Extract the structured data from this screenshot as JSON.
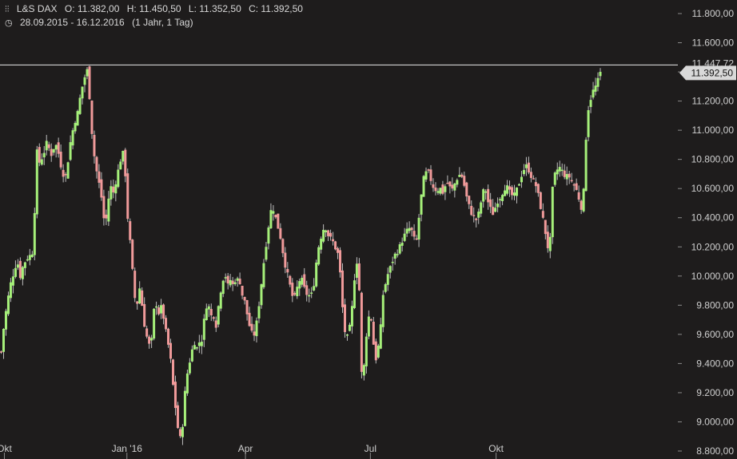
{
  "header": {
    "symbol": "L&S DAX",
    "open": "O: 11.382,00",
    "high": "H: 11.450,50",
    "low": "L: 11.352,50",
    "close": "C: 11.392,50",
    "range": "28.09.2015 - 16.12.2016",
    "interval": "(1 Jahr, 1 Tag)",
    "chart_type_icon": "candlestick-icon",
    "clock_icon": "clock-icon"
  },
  "colors": {
    "background": "#1e1c1c",
    "up": "#a6f07a",
    "down": "#f09a9a",
    "wick": "#bdbdbd",
    "text": "#cfcfcf",
    "price_line": "#e8e8e8",
    "last_price_box": "#d9d9d9"
  },
  "chart_data": {
    "type": "candlestick",
    "title": "L&S DAX",
    "x_range": [
      "2015-09-28",
      "2016-12-16"
    ],
    "x_tick_labels": [
      "Okt",
      "Jan '16",
      "Apr",
      "Jul",
      "Okt"
    ],
    "y_tick_labels": [
      "11.800,00",
      "11.600,00",
      "11.400,00",
      "11.200,00",
      "11.000,00",
      "10.800,00",
      "10.600,00",
      "10.400,00",
      "10.200,00",
      "10.000,00",
      "9.800,00",
      "9.600,00",
      "9.400,00",
      "9.200,00",
      "9.000,00",
      "8.800,00"
    ],
    "ylim": [
      8800,
      11900
    ],
    "grid": false,
    "horizontal_line_label": "11.447,72",
    "last_price_label": "11.392,50",
    "last_price": 11392.5,
    "high_line": 11447.72,
    "close_path": [
      [
        0,
        9480
      ],
      [
        2,
        9600
      ],
      [
        5,
        9720
      ],
      [
        8,
        9830
      ],
      [
        12,
        9950
      ],
      [
        16,
        10030
      ],
      [
        20,
        10110
      ],
      [
        24,
        10000
      ],
      [
        28,
        10080
      ],
      [
        32,
        10120
      ],
      [
        36,
        10140
      ],
      [
        40,
        10170
      ],
      [
        42,
        10450
      ],
      [
        45,
        10850
      ],
      [
        48,
        10780
      ],
      [
        52,
        10820
      ],
      [
        55,
        10870
      ],
      [
        58,
        10930
      ],
      [
        62,
        10820
      ],
      [
        66,
        10880
      ],
      [
        70,
        10900
      ],
      [
        74,
        10780
      ],
      [
        78,
        10700
      ],
      [
        82,
        10680
      ],
      [
        85,
        10850
      ],
      [
        88,
        10950
      ],
      [
        92,
        11050
      ],
      [
        96,
        11120
      ],
      [
        100,
        11250
      ],
      [
        104,
        11350
      ],
      [
        108,
        11410
      ],
      [
        110,
        11320
      ],
      [
        113,
        11050
      ],
      [
        116,
        10860
      ],
      [
        119,
        10750
      ],
      [
        122,
        10650
      ],
      [
        125,
        10600
      ],
      [
        128,
        10420
      ],
      [
        131,
        10350
      ],
      [
        134,
        10480
      ],
      [
        137,
        10640
      ],
      [
        140,
        10550
      ],
      [
        143,
        10620
      ],
      [
        146,
        10700
      ],
      [
        149,
        10770
      ],
      [
        152,
        10850
      ],
      [
        155,
        10820
      ],
      [
        158,
        10450
      ],
      [
        161,
        10300
      ],
      [
        164,
        10100
      ],
      [
        167,
        9900
      ],
      [
        170,
        9750
      ],
      [
        173,
        9950
      ],
      [
        176,
        9850
      ],
      [
        179,
        9700
      ],
      [
        182,
        9600
      ],
      [
        185,
        9550
      ],
      [
        188,
        9480
      ],
      [
        191,
        9720
      ],
      [
        194,
        9850
      ],
      [
        197,
        9720
      ],
      [
        200,
        9800
      ],
      [
        203,
        9750
      ],
      [
        206,
        9650
      ],
      [
        209,
        9550
      ],
      [
        212,
        9480
      ],
      [
        215,
        9300
      ],
      [
        218,
        9150
      ],
      [
        221,
        9000
      ],
      [
        224,
        8880
      ],
      [
        227,
        8900
      ],
      [
        230,
        9150
      ],
      [
        233,
        9300
      ],
      [
        236,
        9400
      ],
      [
        239,
        9450
      ],
      [
        242,
        9580
      ],
      [
        245,
        9480
      ],
      [
        248,
        9560
      ],
      [
        251,
        9520
      ],
      [
        254,
        9650
      ],
      [
        257,
        9780
      ],
      [
        260,
        9830
      ],
      [
        263,
        9700
      ],
      [
        266,
        9780
      ],
      [
        269,
        9620
      ],
      [
        272,
        9750
      ],
      [
        275,
        9880
      ],
      [
        278,
        9950
      ],
      [
        281,
        10050
      ],
      [
        284,
        9900
      ],
      [
        287,
        10000
      ],
      [
        290,
        9920
      ],
      [
        293,
        9980
      ],
      [
        296,
        9960
      ],
      [
        299,
        10000
      ],
      [
        302,
        9880
      ],
      [
        305,
        9850
      ],
      [
        308,
        9770
      ],
      [
        311,
        9680
      ],
      [
        314,
        9620
      ],
      [
        317,
        9580
      ],
      [
        320,
        9640
      ],
      [
        323,
        9760
      ],
      [
        326,
        9900
      ],
      [
        329,
        10050
      ],
      [
        332,
        10180
      ],
      [
        335,
        10300
      ],
      [
        338,
        10430
      ],
      [
        341,
        10480
      ],
      [
        344,
        10420
      ],
      [
        347,
        10350
      ],
      [
        350,
        10300
      ],
      [
        353,
        10200
      ],
      [
        356,
        10100
      ],
      [
        359,
        10030
      ],
      [
        362,
        9960
      ],
      [
        365,
        9880
      ],
      [
        368,
        9830
      ],
      [
        371,
        9900
      ],
      [
        374,
        9960
      ],
      [
        377,
        9990
      ],
      [
        380,
        9930
      ],
      [
        383,
        9880
      ],
      [
        386,
        9870
      ],
      [
        389,
        9860
      ],
      [
        392,
        9900
      ],
      [
        395,
        10050
      ],
      [
        398,
        10180
      ],
      [
        401,
        10250
      ],
      [
        404,
        10310
      ],
      [
        407,
        10350
      ],
      [
        410,
        10290
      ],
      [
        413,
        10260
      ],
      [
        416,
        10250
      ],
      [
        419,
        10200
      ],
      [
        422,
        10180
      ],
      [
        425,
        10100
      ],
      [
        428,
        9850
      ],
      [
        431,
        9650
      ],
      [
        434,
        9560
      ],
      [
        437,
        9620
      ],
      [
        440,
        9700
      ],
      [
        443,
        9950
      ],
      [
        446,
        10060
      ],
      [
        449,
        10180
      ],
      [
        452,
        9350
      ],
      [
        455,
        9300
      ],
      [
        458,
        9550
      ],
      [
        461,
        9700
      ],
      [
        464,
        9760
      ],
      [
        467,
        9600
      ],
      [
        470,
        9400
      ],
      [
        473,
        9500
      ],
      [
        476,
        9550
      ],
      [
        479,
        9850
      ],
      [
        482,
        9920
      ],
      [
        485,
        10000
      ],
      [
        488,
        10040
      ],
      [
        491,
        10090
      ],
      [
        494,
        10140
      ],
      [
        497,
        10160
      ],
      [
        500,
        10190
      ],
      [
        503,
        10230
      ],
      [
        506,
        10270
      ],
      [
        509,
        10300
      ],
      [
        512,
        10330
      ],
      [
        515,
        10320
      ],
      [
        518,
        10280
      ],
      [
        521,
        10200
      ],
      [
        524,
        10350
      ],
      [
        527,
        10500
      ],
      [
        530,
        10650
      ],
      [
        533,
        10700
      ],
      [
        536,
        10720
      ],
      [
        539,
        10680
      ],
      [
        542,
        10620
      ],
      [
        545,
        10600
      ],
      [
        548,
        10580
      ],
      [
        551,
        10620
      ],
      [
        554,
        10560
      ],
      [
        557,
        10600
      ],
      [
        560,
        10650
      ],
      [
        563,
        10620
      ],
      [
        566,
        10580
      ],
      [
        569,
        10620
      ],
      [
        572,
        10660
      ],
      [
        575,
        10690
      ],
      [
        578,
        10700
      ],
      [
        581,
        10650
      ],
      [
        584,
        10560
      ],
      [
        587,
        10500
      ],
      [
        590,
        10440
      ],
      [
        593,
        10420
      ],
      [
        596,
        10380
      ],
      [
        599,
        10400
      ],
      [
        602,
        10480
      ],
      [
        605,
        10560
      ],
      [
        608,
        10620
      ],
      [
        611,
        10520
      ],
      [
        614,
        10480
      ],
      [
        617,
        10420
      ],
      [
        620,
        10450
      ],
      [
        623,
        10510
      ],
      [
        626,
        10530
      ],
      [
        629,
        10560
      ],
      [
        632,
        10600
      ],
      [
        635,
        10620
      ],
      [
        638,
        10580
      ],
      [
        641,
        10560
      ],
      [
        644,
        10540
      ],
      [
        647,
        10580
      ],
      [
        650,
        10620
      ],
      [
        653,
        10680
      ],
      [
        656,
        10720
      ],
      [
        659,
        10760
      ],
      [
        662,
        10740
      ],
      [
        665,
        10700
      ],
      [
        668,
        10660
      ],
      [
        671,
        10640
      ],
      [
        674,
        10580
      ],
      [
        677,
        10500
      ],
      [
        680,
        10420
      ],
      [
        683,
        10320
      ],
      [
        686,
        10250
      ],
      [
        689,
        10100
      ],
      [
        692,
        10550
      ],
      [
        695,
        10680
      ],
      [
        698,
        10720
      ],
      [
        701,
        10750
      ],
      [
        704,
        10730
      ],
      [
        707,
        10700
      ],
      [
        710,
        10680
      ],
      [
        713,
        10690
      ],
      [
        716,
        10660
      ],
      [
        719,
        10640
      ],
      [
        722,
        10600
      ],
      [
        725,
        10560
      ],
      [
        728,
        10480
      ],
      [
        731,
        10460
      ],
      [
        733,
        10700
      ],
      [
        735,
        10950
      ],
      [
        738,
        11150
      ],
      [
        741,
        11220
      ],
      [
        744,
        11270
      ],
      [
        747,
        11300
      ],
      [
        750,
        11340
      ],
      [
        753,
        11392.5
      ]
    ],
    "note": "close_path lists approximate daily price levels (data units) read from the candlestick chart; first number is trading-day index from 28.09.2015"
  }
}
